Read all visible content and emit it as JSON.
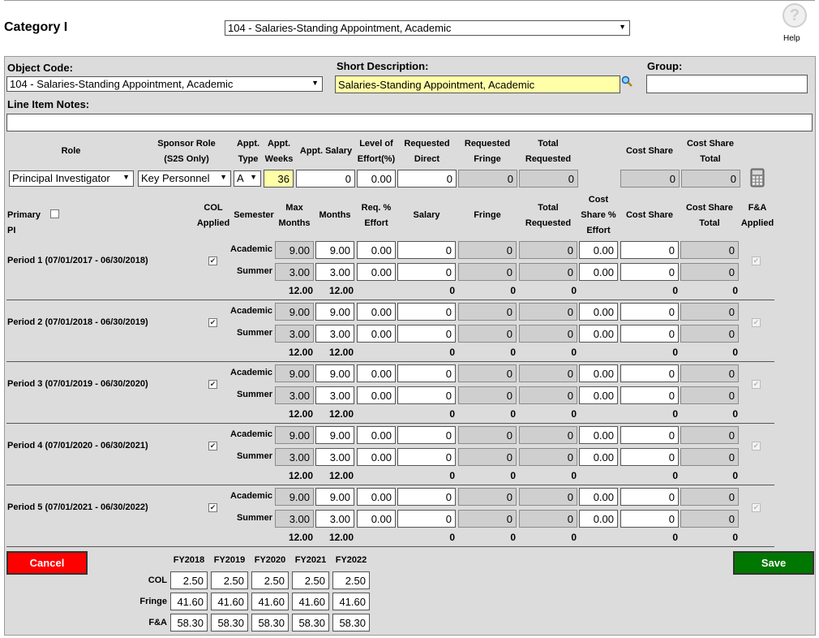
{
  "header": {
    "title": "Category I",
    "category_select": "104 - Salaries-Standing Appointment, Academic",
    "help_label": "Help"
  },
  "form": {
    "object_code_label": "Object Code:",
    "object_code_value": "104 - Salaries-Standing Appointment, Academic",
    "short_desc_label": "Short Description:",
    "short_desc_value": "Salaries-Standing Appointment, Academic",
    "group_label": "Group:",
    "group_value": "",
    "notes_label": "Line Item Notes:",
    "notes_value": ""
  },
  "role_headers": [
    {
      "key": "role",
      "lines": [
        "Role"
      ]
    },
    {
      "key": "sponsor",
      "lines": [
        "Sponsor Role",
        "(S2S Only)"
      ]
    },
    {
      "key": "appt_type",
      "lines": [
        "Appt.",
        "Type"
      ]
    },
    {
      "key": "appt_weeks",
      "lines": [
        "Appt.",
        "Weeks"
      ]
    },
    {
      "key": "appt_salary",
      "lines": [
        "Appt. Salary"
      ]
    },
    {
      "key": "effort",
      "lines": [
        "Level of",
        "Effort(%)"
      ]
    },
    {
      "key": "req_direct",
      "lines": [
        "Requested",
        "Direct"
      ]
    },
    {
      "key": "req_fringe",
      "lines": [
        "Requested",
        "Fringe"
      ]
    },
    {
      "key": "total_req",
      "lines": [
        "Total",
        "Requested"
      ]
    },
    {
      "key": "cost_share",
      "lines": [
        "Cost Share"
      ]
    },
    {
      "key": "cs_total",
      "lines": [
        "Cost Share",
        "Total"
      ]
    }
  ],
  "role_row": {
    "role": "Principal Investigator",
    "sponsor_role": "Key Personnel",
    "appt_type": "A",
    "appt_weeks": "36",
    "appt_salary": "0",
    "effort": "0.00",
    "req_direct": "0",
    "req_fringe": "0",
    "total_req": "0",
    "cost_share": "0",
    "cs_total": "0",
    "calculator_icon": "calculator-icon"
  },
  "period_headers": [
    {
      "key": "primary_pi",
      "lines": [
        "Primary PI"
      ]
    },
    {
      "key": "col",
      "lines": [
        "COL",
        "Applied"
      ]
    },
    {
      "key": "semester",
      "lines": [
        "Semester"
      ]
    },
    {
      "key": "max_months",
      "lines": [
        "Max",
        "Months"
      ]
    },
    {
      "key": "months",
      "lines": [
        "Months"
      ]
    },
    {
      "key": "req_effort",
      "lines": [
        "Req. %",
        "Effort"
      ]
    },
    {
      "key": "salary",
      "lines": [
        "Salary"
      ]
    },
    {
      "key": "fringe",
      "lines": [
        "Fringe"
      ]
    },
    {
      "key": "total_req",
      "lines": [
        "Total",
        "Requested"
      ]
    },
    {
      "key": "cs_effort",
      "lines": [
        "Cost",
        "Share %",
        "Effort"
      ]
    },
    {
      "key": "cost_share",
      "lines": [
        "Cost Share"
      ]
    },
    {
      "key": "cs_total",
      "lines": [
        "Cost Share",
        "Total"
      ]
    },
    {
      "key": "fa",
      "lines": [
        "F&A",
        "Applied"
      ]
    }
  ],
  "periods": [
    {
      "label": "Period 1 (07/01/2017 - 06/30/2018)"
    },
    {
      "label": "Period 2 (07/01/2018 - 06/30/2019)"
    },
    {
      "label": "Period 3 (07/01/2019 - 06/30/2020)"
    },
    {
      "label": "Period 4 (07/01/2020 - 06/30/2021)"
    },
    {
      "label": "Period 5 (07/01/2021 - 06/30/2022)"
    }
  ],
  "period_rows": {
    "academic": {
      "semester": "Academic",
      "max_months": "9.00",
      "months": "9.00",
      "req_effort": "0.00",
      "salary": "0",
      "fringe": "0",
      "total": "0",
      "cs_effort": "0.00",
      "cost_share": "0",
      "cs_total": "0"
    },
    "summer": {
      "semester": "Summer",
      "max_months": "3.00",
      "months": "3.00",
      "req_effort": "0.00",
      "salary": "0",
      "fringe": "0",
      "total": "0",
      "cs_effort": "0.00",
      "cost_share": "0",
      "cs_total": "0"
    },
    "totals": {
      "max_months": "12.00",
      "months": "12.00",
      "salary": "0",
      "fringe": "0",
      "total": "0",
      "cost_share": "0",
      "cs_total": "0"
    }
  },
  "rates": {
    "years": [
      "FY2018",
      "FY2019",
      "FY2020",
      "FY2021",
      "FY2022"
    ],
    "rows": [
      {
        "label": "COL",
        "values": [
          "2.50",
          "2.50",
          "2.50",
          "2.50",
          "2.50"
        ]
      },
      {
        "label": "Fringe",
        "values": [
          "41.60",
          "41.60",
          "41.60",
          "41.60",
          "41.60"
        ]
      },
      {
        "label": "F&A",
        "values": [
          "58.30",
          "58.30",
          "58.30",
          "58.30",
          "58.30"
        ]
      }
    ]
  },
  "buttons": {
    "cancel": "Cancel",
    "save": "Save",
    "cancel_color": "#ff0000",
    "save_color": "#007700"
  }
}
